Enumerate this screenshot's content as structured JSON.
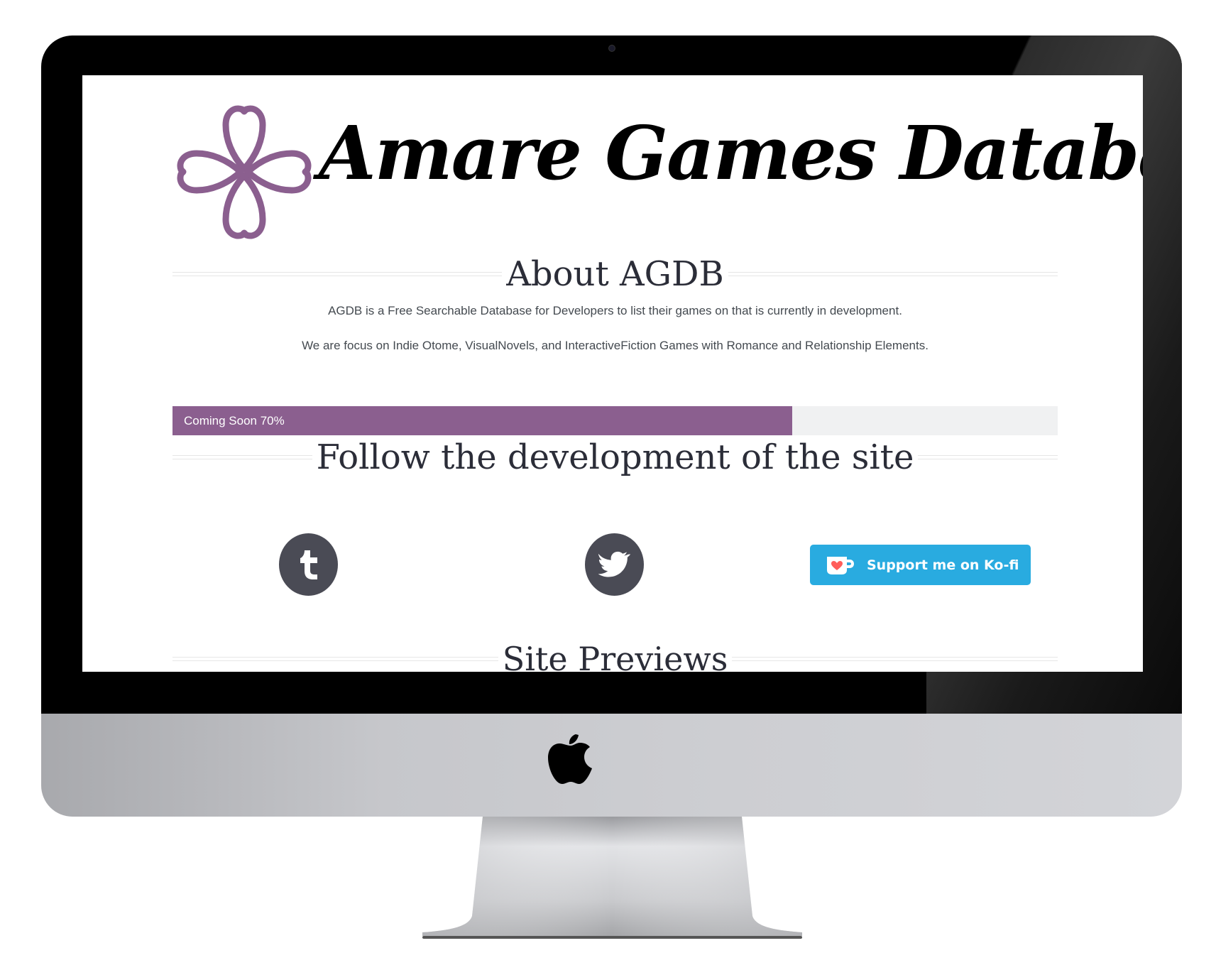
{
  "logo": {
    "text": "Amare Games Database",
    "icon": "heart-clover-icon",
    "icon_color": "#8b5f8f"
  },
  "about": {
    "title": "About AGDB",
    "paragraph_1": "AGDB is a Free Searchable Database for Developers to list their games on that is currently in development.",
    "paragraph_2": "We are focus on Indie Otome, VisualNovels, and InteractiveFiction Games with Romance and Relationship Elements."
  },
  "progress": {
    "label": "Coming Soon 70%",
    "value_percent": 70,
    "fill_color": "#8b5f8f",
    "track_color": "#f0f1f2"
  },
  "follow": {
    "title": "Follow the development of the site",
    "social": [
      {
        "icon": "tumblr-icon"
      },
      {
        "icon": "twitter-icon"
      }
    ],
    "kofi": {
      "label": "Support me on Ko-fi",
      "icon": "kofi-cup-icon",
      "color": "#29abe0"
    }
  },
  "previews": {
    "title": "Site Previews"
  },
  "colors": {
    "heading": "#2b2d38",
    "body_text": "#444a50",
    "social_circle": "#4a4b55"
  }
}
